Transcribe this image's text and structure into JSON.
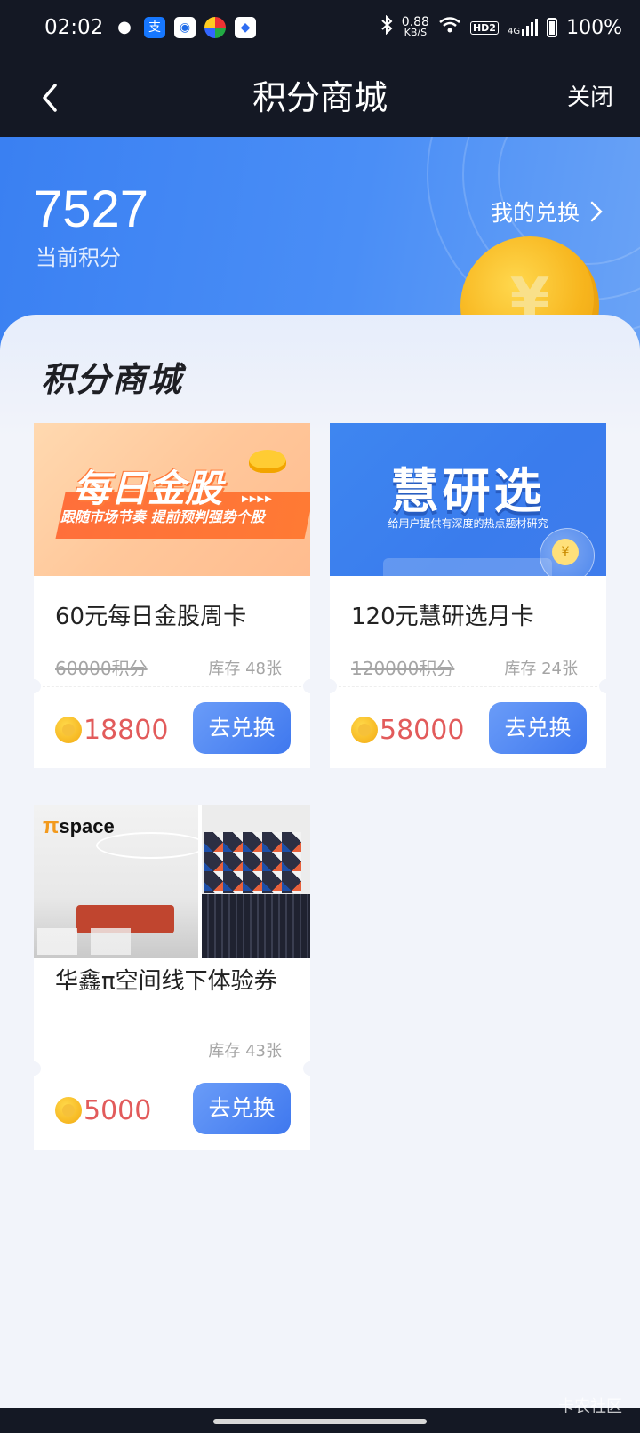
{
  "status_bar": {
    "time": "02:02",
    "network_speed_value": "0.88",
    "network_speed_unit": "KB/S",
    "hd_label": "HD2",
    "signal_label": "4G",
    "battery": "100%",
    "apps": [
      "wechat",
      "alipay",
      "browser",
      "app-colorful",
      "baidu"
    ]
  },
  "navbar": {
    "title": "积分商城",
    "close_label": "关闭"
  },
  "points": {
    "value": "7527",
    "label": "当前积分",
    "my_exchange_label": "我的兑换",
    "coin_symbol": "¥"
  },
  "section_title": "积分商城",
  "products": [
    {
      "name": "60元每日金股周卡",
      "original_price": "60000积分",
      "stock": "库存 48张",
      "price": "18800",
      "button_label": "去兑换",
      "banner": {
        "headline": "每日金股",
        "subline": "跟随市场节奏 提前预判强势个股"
      }
    },
    {
      "name": "120元慧研选月卡",
      "original_price": "120000积分",
      "stock": "库存 24张",
      "price": "58000",
      "button_label": "去兑换",
      "banner": {
        "headline": "慧研选",
        "subline": "给用户提供有深度的热点题材研究",
        "coin_symbol": "¥"
      }
    },
    {
      "name": "华鑫π空间线下体验券",
      "original_price": "",
      "stock": "库存 43张",
      "price": "5000",
      "button_label": "去兑换",
      "banner": {
        "logo_pi": "π",
        "logo_text": "space"
      }
    }
  ],
  "watermark": "卡农社区",
  "colors": {
    "dark_bar": "#141824",
    "hero_blue": "#3a80f2",
    "price_red": "#e25b5b",
    "button_blue": "#3f78ee",
    "coin_gold": "#f7b51d"
  }
}
